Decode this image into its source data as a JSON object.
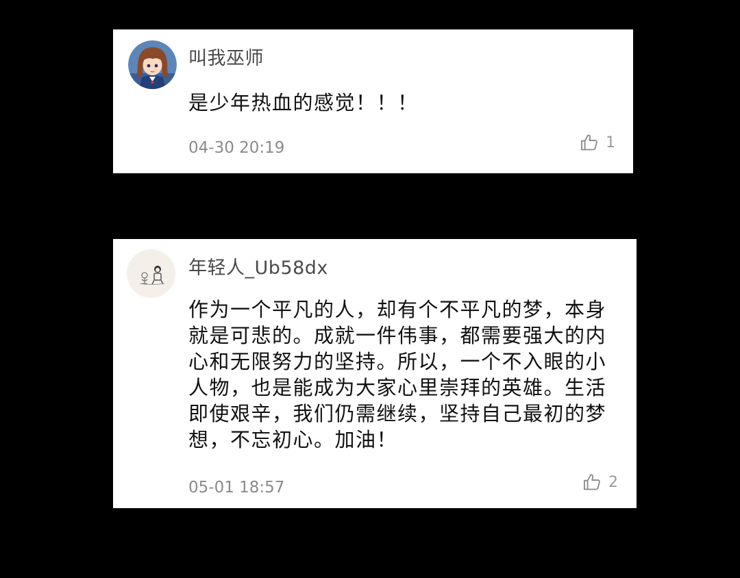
{
  "comments": [
    {
      "username": "叫我巫师",
      "avatar_icon": "anime-girl-avatar-icon",
      "content": "是少年热血的感觉！！！",
      "timestamp": "04-30 20:19",
      "like_icon": "thumbs-up-icon",
      "likes": "1"
    },
    {
      "username": "年轻人_Ub58dx",
      "avatar_icon": "doodle-avatar-icon",
      "content": "作为一个平凡的人，却有个不平凡的梦，本身就是可悲的。成就一件伟事，都需要强大的内心和无限努力的坚持。所以，一个不入眼的小人物，也是能成为大家心里崇拜的英雄。生活即使艰辛，我们仍需继续，坚持自己最初的梦想，不忘初心。加油！",
      "timestamp": "05-01 18:57",
      "like_icon": "thumbs-up-icon",
      "likes": "2"
    }
  ],
  "colors": {
    "background": "#000000",
    "card": "#ffffff",
    "username": "#4a4a4a",
    "content": "#111111",
    "meta": "#8a8a8a"
  }
}
